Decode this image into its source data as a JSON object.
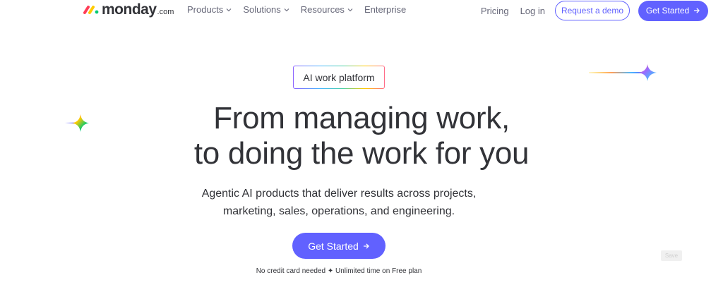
{
  "logo": {
    "word": "monday",
    "suffix": ".com",
    "colors": [
      "#ff3d57",
      "#ffcb00",
      "#00ca72"
    ]
  },
  "nav": {
    "items": [
      {
        "label": "Products",
        "has_dropdown": true
      },
      {
        "label": "Solutions",
        "has_dropdown": true
      },
      {
        "label": "Resources",
        "has_dropdown": true
      },
      {
        "label": "Enterprise",
        "has_dropdown": false
      }
    ],
    "pricing": "Pricing",
    "login": "Log in",
    "request_demo": "Request a demo",
    "get_started": "Get Started"
  },
  "hero": {
    "badge": "AI work platform",
    "headline_line1": "From managing work,",
    "headline_line2": "to doing the work for you",
    "subhead_line1": "Agentic AI products that deliver results across projects,",
    "subhead_line2": "marketing, sales, operations, and engineering.",
    "cta": "Get Started",
    "footnote": "No credit card needed ✦ Unlimited time on Free plan",
    "save_chip": "Save"
  },
  "colors": {
    "accent": "#6161ff",
    "text": "#323338",
    "muted": "#676879"
  },
  "icons": {
    "chevron": "chevron-down-icon",
    "arrow": "arrow-right-icon",
    "sparkle": "sparkle-icon"
  }
}
